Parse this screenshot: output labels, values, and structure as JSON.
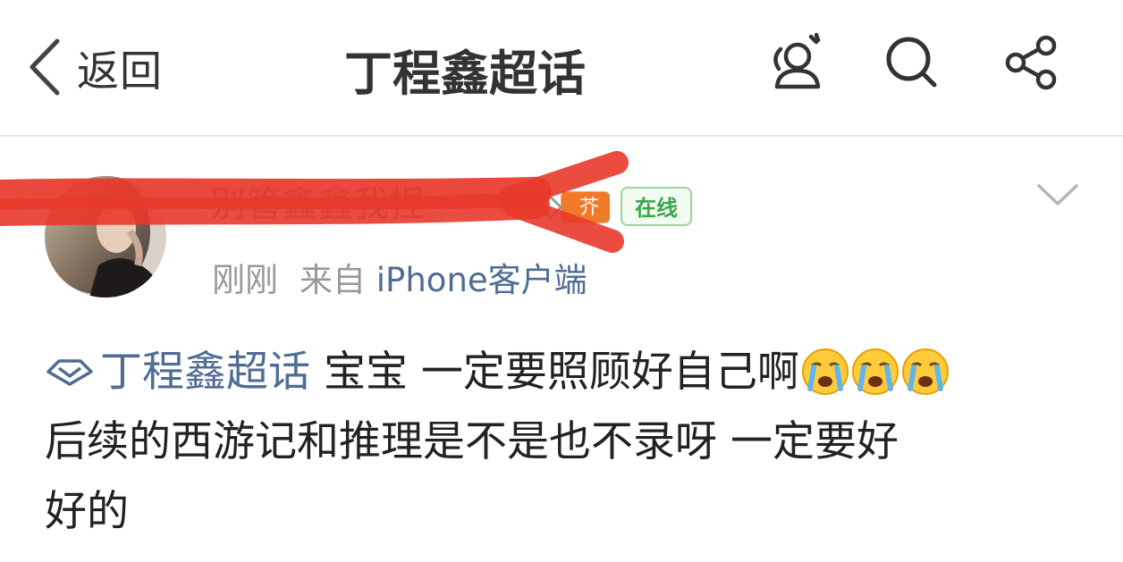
{
  "nav": {
    "back_label": "返回",
    "title": "丁程鑫超话"
  },
  "post": {
    "username": "别管鑫鑫我捏",
    "badge_text": "芥",
    "online_label": "在线",
    "time": "刚刚",
    "source_prefix": "来自",
    "source_client": "iPhone客户端",
    "topic_tag": "丁程鑫超话",
    "line1_text": "宝宝 一定要照顾好自己啊",
    "emoji_name": "crying-face",
    "line2_text": "后续的西游记和推理是不是也不录呀 一定要好",
    "line3_text": "好的"
  },
  "colors": {
    "topic_link": "#4f6c94",
    "online_green": "#3aa64a",
    "scribble_red": "#e8382b",
    "badge_orange": "#f07a2a"
  }
}
